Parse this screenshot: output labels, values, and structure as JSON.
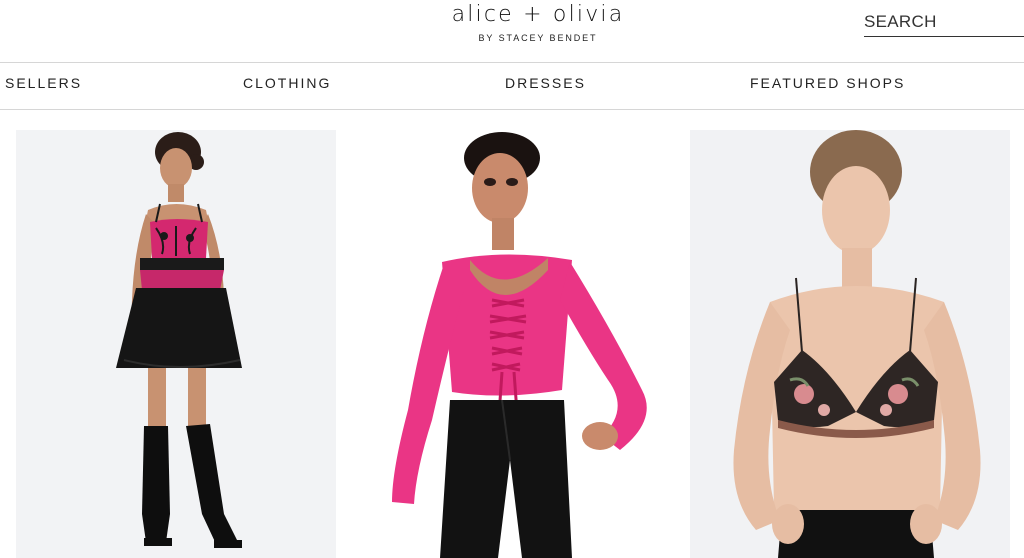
{
  "brand": {
    "name": "alice + olivia",
    "tagline": "BY STACEY BENDET"
  },
  "search": {
    "placeholder": "SEARCH"
  },
  "nav": {
    "items": [
      {
        "label": "SELLERS"
      },
      {
        "label": "CLOTHING"
      },
      {
        "label": "DRESSES"
      },
      {
        "label": "FEATURED SHOPS"
      }
    ]
  },
  "products": [
    {
      "image": "model in pink lace corset mini dress with black knee-high boots"
    },
    {
      "image": "model in pink lace-up long sleeve crop top with black trousers"
    },
    {
      "image": "model in floral print twist bralette with black trousers"
    }
  ],
  "colors": {
    "accent_pink": "#e8307a",
    "text": "#111111",
    "divider": "#d6d6d6"
  }
}
